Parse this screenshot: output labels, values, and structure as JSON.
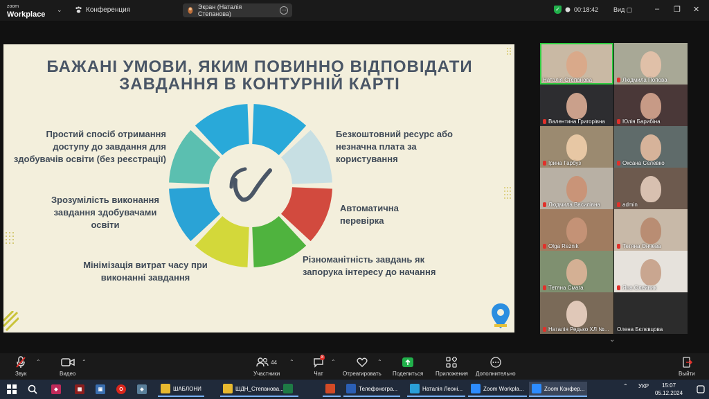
{
  "topbar": {
    "brand_line1": "zoom",
    "brand_line2": "Workplace",
    "conference_label": "Конференция",
    "share_label": "Экран (Наталія Степанова)",
    "timer": "00:18:42",
    "view_label": "Вид"
  },
  "slide": {
    "title_line1": "БАЖАНІ УМОВИ, ЯКИМ ПОВИННО ВІДПОВІДАТИ",
    "title_line2": "ЗАВДАННЯ В КОНТУРНІЙ КАРТІ",
    "item1": [
      "Простий спосіб отримання",
      "доступу до завдання для",
      "здобувачів освіти (без реєстрації)"
    ],
    "item2": [
      "Зрозумілість виконання",
      "завдання здобувачами",
      "освіти"
    ],
    "item3": [
      "Мінімізація витрат часу при",
      "виконанні завдання"
    ],
    "item4": [
      "Безкоштовний ресурс або",
      "незначна плата за",
      "користування"
    ],
    "item5": [
      "Автоматична",
      "перевірка"
    ],
    "item6": [
      "Різноманітність завдань як",
      "запорука інтересу до начання"
    ],
    "wheel_colors": [
      "#29a9d9",
      "#c7dfe3",
      "#d24a3e",
      "#4fb33e",
      "#d3d83a",
      "#2aa3d6",
      "#5bbfb0",
      "#29a9d9"
    ]
  },
  "participants": [
    {
      "name": "Наталія Степанова",
      "bg": "#c9b9a4",
      "face": "#d9a98a",
      "active": true,
      "muted": false
    },
    {
      "name": "Людмила Попова",
      "bg": "#a8a896",
      "face": "#e0c0a8",
      "active": false,
      "muted": true
    },
    {
      "name": "Валентина  Григорівна",
      "bg": "#2d2d30",
      "face": "#caa08b",
      "active": false,
      "muted": true
    },
    {
      "name": "Юлія Барибіна",
      "bg": "#4a3838",
      "face": "#c79a86",
      "active": false,
      "muted": true
    },
    {
      "name": "Ірина Гарбуз",
      "bg": "#9b8a70",
      "face": "#e7c7a4",
      "active": false,
      "muted": true
    },
    {
      "name": "Оксана Селевко",
      "bg": "#5f6b6a",
      "face": "#d6b39a",
      "active": false,
      "muted": true
    },
    {
      "name": "Людмила Василівна",
      "bg": "#b8b0a4",
      "face": "#c99478",
      "active": false,
      "muted": true
    },
    {
      "name": "admin",
      "bg": "#6d5a4e",
      "face": "#d8c0b0",
      "active": false,
      "muted": true
    },
    {
      "name": "Olga Reznik",
      "bg": "#a07c60",
      "face": "#c49276",
      "active": false,
      "muted": true
    },
    {
      "name": "Тетяна Ончева",
      "bg": "#c8b9a8",
      "face": "#b98d73",
      "active": false,
      "muted": true
    },
    {
      "name": "Тетяна Смага",
      "bg": "#7f9070",
      "face": "#d4b094",
      "active": false,
      "muted": true
    },
    {
      "name": "Яна Олейник",
      "bg": "#e6e2dc",
      "face": "#c9a690",
      "active": false,
      "muted": true
    },
    {
      "name": "Наталія Редько ХЛ №...",
      "bg": "#7a6a58",
      "face": "#e0c8b8",
      "active": false,
      "muted": true
    },
    {
      "name": "Олена Бєлєвцова",
      "bg": "#2c2c2c",
      "face": "",
      "active": false,
      "muted": false
    }
  ],
  "toolbar": {
    "audio_label": "Звук",
    "video_label": "Видео",
    "participants_label": "Участники",
    "participants_count": "44",
    "chat_label": "Чат",
    "chat_badge": "8",
    "react_label": "Отреагировать",
    "share_label": "Поделиться",
    "apps_label": "Приложения",
    "more_label": "Дополнительно",
    "leave_label": "Выйти"
  },
  "taskbar": {
    "items": [
      {
        "label": "ШАБЛОНИ",
        "color": "#e8b92f"
      },
      {
        "label": "ШДН_Степанова...",
        "color": "#e8b92f"
      },
      {
        "label": "",
        "color": "#1e7b45"
      },
      {
        "label": "",
        "color": "#d24a26"
      },
      {
        "label": "Телефоногра...",
        "color": "#2b5fb5"
      },
      {
        "label": "Наталія Леоні...",
        "color": "#2a9fd8"
      },
      {
        "label": "Zoom Workpla...",
        "color": "#2d8cff"
      },
      {
        "label": "Zoom Конфер...",
        "color": "#2d8cff"
      }
    ],
    "lang": "УКР",
    "time": "15:07",
    "date": "05.12.2024"
  }
}
